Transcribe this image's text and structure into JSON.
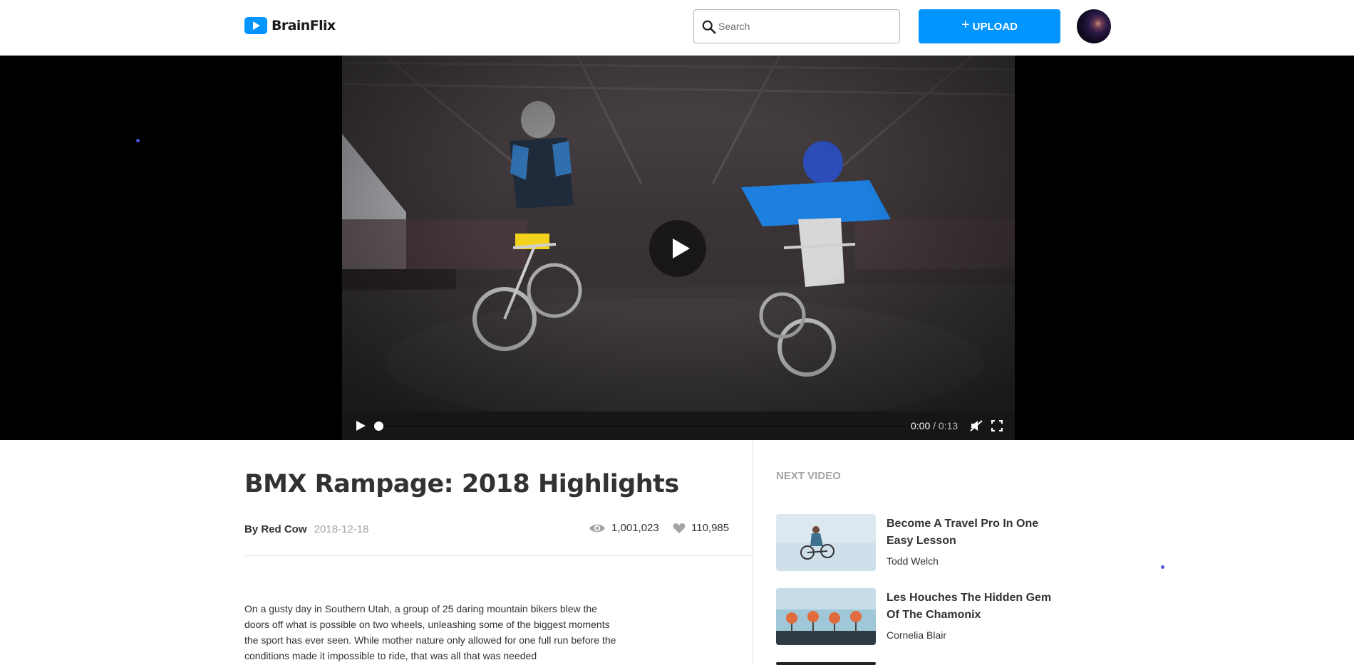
{
  "header": {
    "logo_text": "BrainFlix",
    "search_placeholder": "Search",
    "upload_label": "UPLOAD"
  },
  "player": {
    "current_time": "0:00",
    "separator": "/",
    "duration": "0:13",
    "progress": 0
  },
  "video": {
    "title": "BMX Rampage: 2018 Highlights",
    "author": "By Red Cow",
    "date": "2018-12-18",
    "views": "1,001,023",
    "likes": "110,985",
    "description": "On a gusty day in Southern Utah, a group of 25 daring mountain bikers blew the doors off what is possible on two wheels, unleashing some of the biggest moments the sport has ever seen. While mother nature only allowed for one full run before the conditions made it impossible to ride, that was all that was needed"
  },
  "sidebar": {
    "heading": "NEXT VIDEO",
    "items": [
      {
        "title": "Become A Travel Pro In One Easy Lesson",
        "channel": "Todd Welch"
      },
      {
        "title": "Les Houches The Hidden Gem Of The Chamonix",
        "channel": "Cornelia Blair"
      }
    ]
  },
  "colors": {
    "accent": "#0095ff",
    "text": "#323232",
    "muted": "#a4a4a4"
  }
}
